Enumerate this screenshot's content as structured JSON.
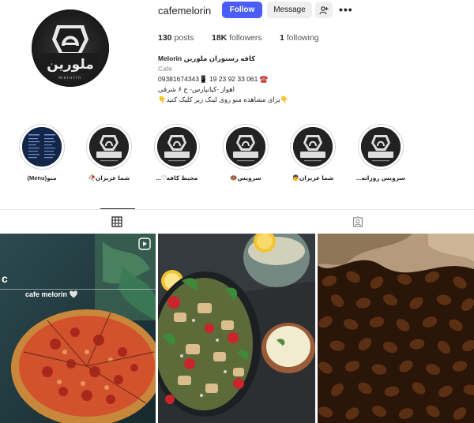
{
  "profile": {
    "username": "cafemelorin",
    "follow_label": "Follow",
    "message_label": "Message",
    "more_label": "•••",
    "logo_text": "ملورین",
    "logo_sub": "melorin"
  },
  "stats": {
    "posts_count": "130",
    "posts_label": "posts",
    "followers_count": "18K",
    "followers_label": "followers",
    "following_count": "1",
    "following_label": "following"
  },
  "bio": {
    "name": "Melorin کافه رستوران ملورین",
    "category": "Cafe",
    "phone": "09381674343📱 19 23 92 33 061 ☎️",
    "address": "اهواز -کیانپارس- خ ۶ شرقی",
    "menu_note": "👇برای مشاهده منو روی لینک زیر کلیک کنید👇"
  },
  "highlights": [
    {
      "label": "منو(Menu)"
    },
    {
      "label": "شما عزیزان🥀"
    },
    {
      "label": "محیط کافه♡..."
    },
    {
      "label": "سرویس🍩"
    },
    {
      "label": "شما عزیزان👨"
    },
    {
      "label": "سرویس روزانه..."
    }
  ],
  "tabs": [
    {
      "name": "posts",
      "icon": "grid-icon",
      "active": true
    },
    {
      "name": "tagged",
      "icon": "tagged-icon",
      "active": false
    }
  ],
  "posts": [
    {
      "type": "pizza",
      "caption": "cafe melorin 🤍",
      "edge_text": "c",
      "icon": "reel-icon"
    },
    {
      "type": "salad"
    },
    {
      "type": "coffee-beans"
    }
  ],
  "colors": {
    "follow_button": "#4a5df9",
    "secondary_button": "#efefef",
    "text": "#262626",
    "muted": "#8e8e8e"
  }
}
